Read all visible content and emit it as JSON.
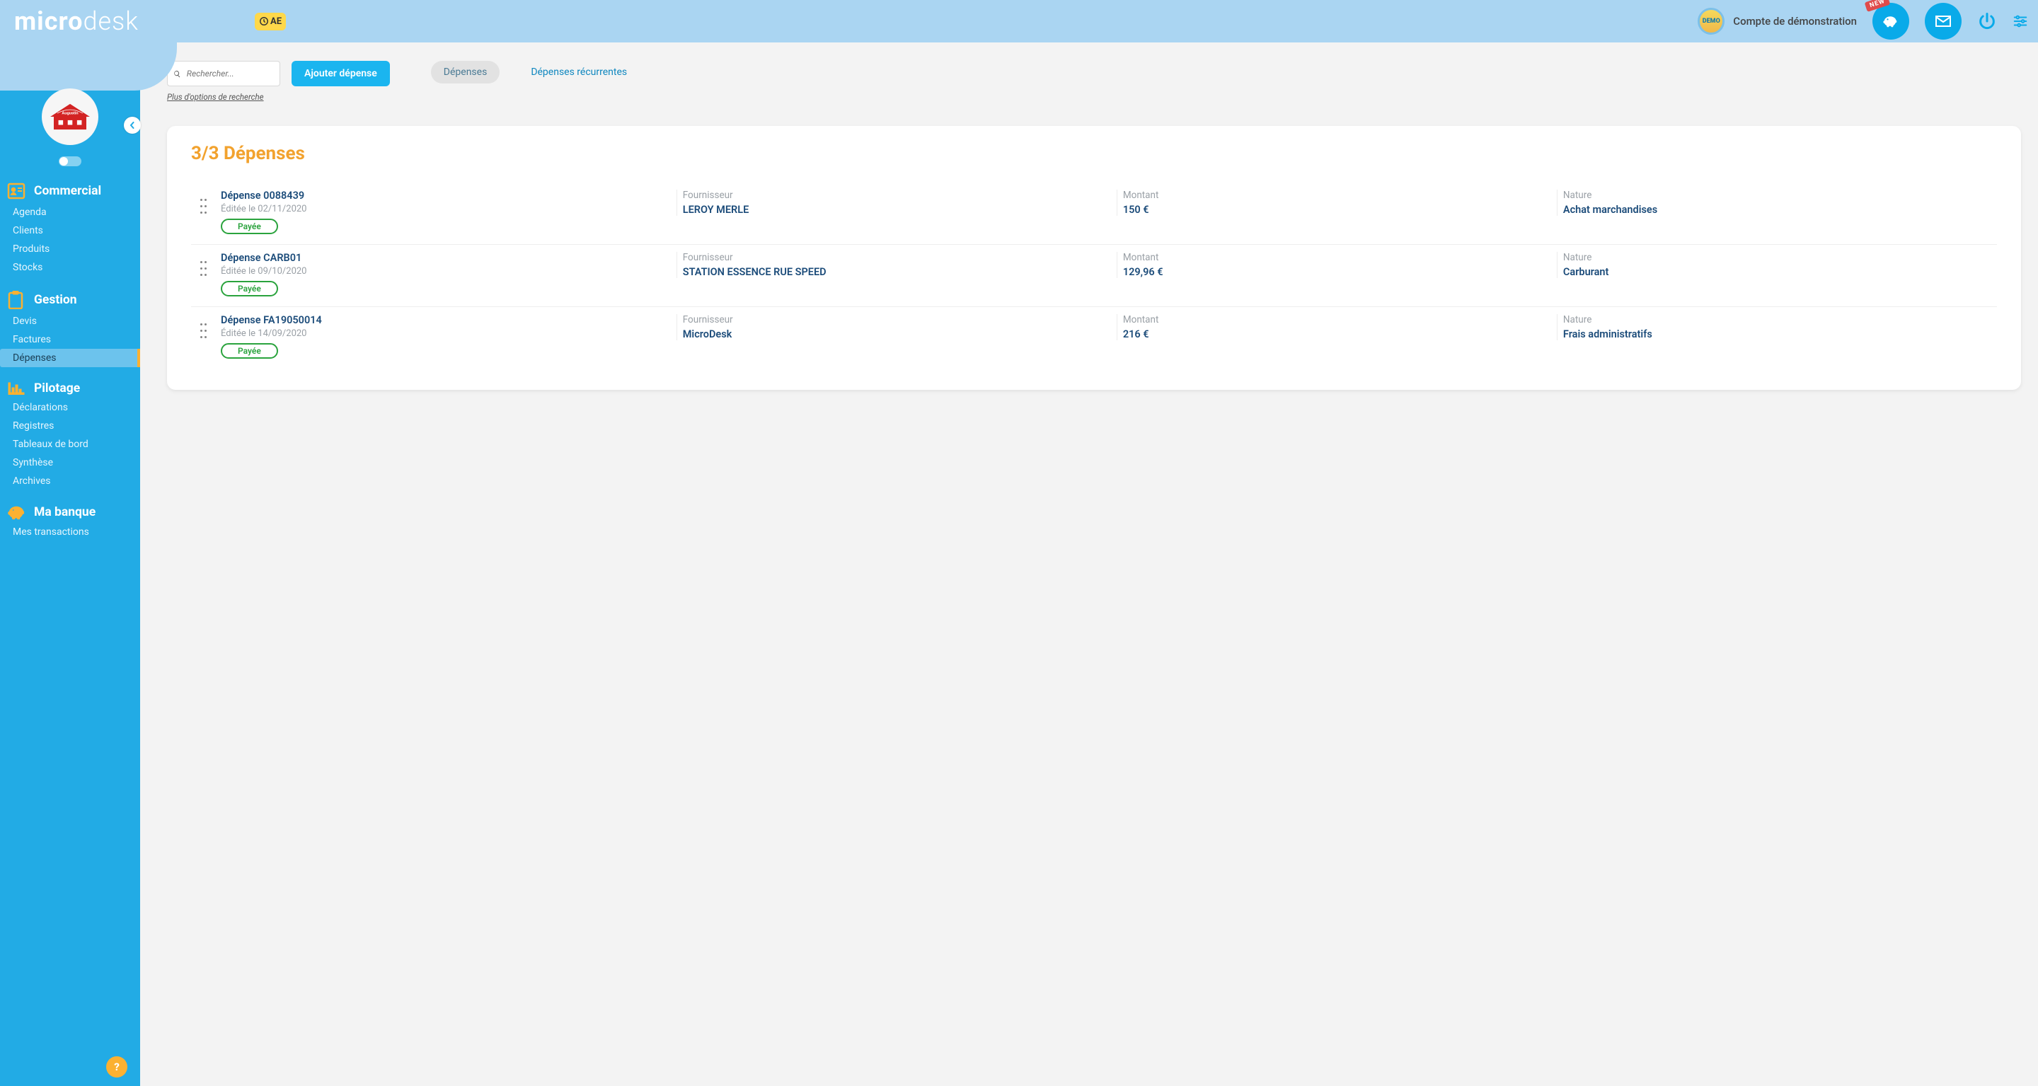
{
  "brand": {
    "part1": "micro",
    "part2": "desk"
  },
  "ae_tag": "AE",
  "account_label": "Compte de démonstration",
  "demo_badge": "DEMO",
  "new_ribbon": "NEW",
  "search": {
    "placeholder": "Rechercher...",
    "more_options": "Plus d'options de recherche"
  },
  "btn_add": "Ajouter dépense",
  "tabs": {
    "t1": "Dépenses",
    "t2": "Dépenses récurrentes"
  },
  "card_title": "3/3 Dépenses",
  "columns": {
    "supplier": "Fournisseur",
    "amount": "Montant",
    "nature": "Nature"
  },
  "status_paid": "Payée",
  "nav": {
    "commercial": {
      "header": "Commercial",
      "items": [
        "Agenda",
        "Clients",
        "Produits",
        "Stocks"
      ]
    },
    "gestion": {
      "header": "Gestion",
      "items": [
        "Devis",
        "Factures",
        "Dépenses"
      ]
    },
    "pilotage": {
      "header": "Pilotage",
      "items": [
        "Déclarations",
        "Registres",
        "Tableaux de bord",
        "Synthèse",
        "Archives"
      ]
    },
    "bank": {
      "header": "Ma banque",
      "items": [
        "Mes transactions"
      ]
    }
  },
  "expenses": [
    {
      "title": "Dépense 0088439",
      "sub": "Éditée le 02/11/2020",
      "supplier": "LEROY MERLE",
      "amount": "150 €",
      "nature": "Achat marchandises"
    },
    {
      "title": "Dépense CARB01",
      "sub": "Éditée le 09/10/2020",
      "supplier": "STATION ESSENCE RUE SPEED",
      "amount": "129,96 €",
      "nature": "Carburant"
    },
    {
      "title": "Dépense FA19050014",
      "sub": "Éditée le 14/09/2020",
      "supplier": "MicroDesk",
      "amount": "216 €",
      "nature": "Frais administratifs"
    }
  ],
  "help": "?"
}
